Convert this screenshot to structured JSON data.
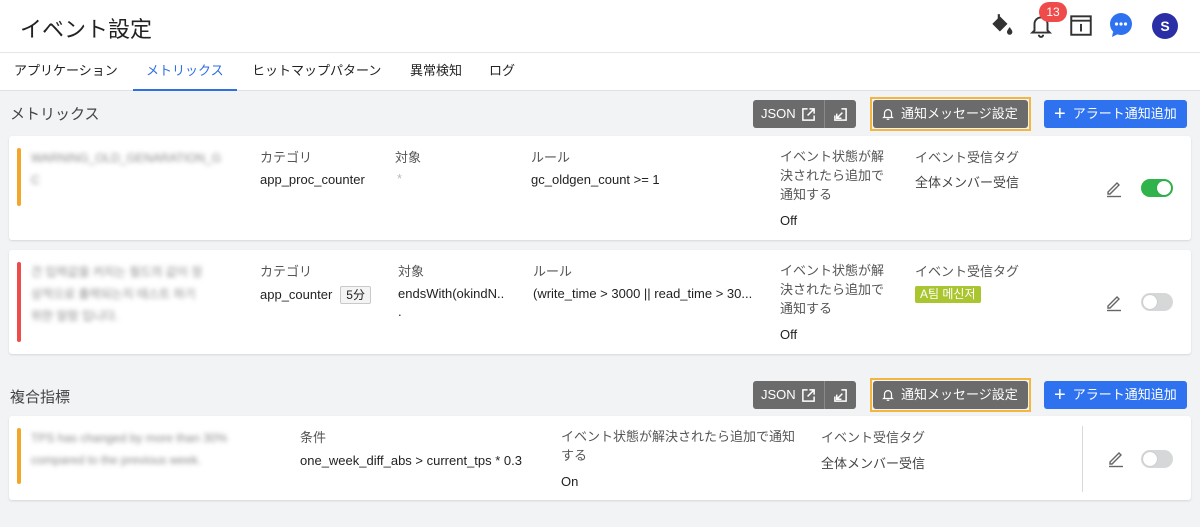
{
  "header": {
    "title": "イベント設定",
    "notification_count": "13",
    "avatar_initial": "S"
  },
  "tabs": [
    {
      "label": "アプリケーション"
    },
    {
      "label": "メトリックス",
      "active": true
    },
    {
      "label": "ヒットマップパターン"
    },
    {
      "label": "異常検知"
    },
    {
      "label": "ログ"
    }
  ],
  "toolbar": {
    "json_label": "JSON",
    "notify_label": "通知メッセージ設定",
    "add_label": "アラート通知追加"
  },
  "metrics": {
    "section_title": "メトリックス",
    "labels": {
      "category": "カテゴリ",
      "target": "対象",
      "rule": "ルール",
      "resolved_line1": "イベント状態が解",
      "resolved_line2": "決されたら追加で",
      "resolved_line3": "通知する",
      "tag": "イベント受信タグ"
    },
    "rows": [
      {
        "name_line1": "WARNING_OLD_GENARATION_G",
        "name_line2": "C",
        "category": "app_proc_counter",
        "target": "*",
        "rule": "gc_oldgen_count >= 1",
        "resolved": "Off",
        "tag": "全体メンバー受信",
        "enabled": true,
        "stripe_color": "#f4a62a"
      },
      {
        "name_line1": "건 입력값을 커지는 필드의 값이 정",
        "name_line2": "상적으로 출력되는지 테스트 하기",
        "name_line3": "위한 알람 입니다.",
        "category": "app_counter",
        "interval": "5分",
        "target": "endsWith(okindN..",
        "target_extra": ".",
        "rule": "(write_time > 3000 || read_time > 30...",
        "resolved": "Off",
        "tag": "A팀 메신저",
        "enabled": false,
        "stripe_color": "#ee4b4b"
      }
    ]
  },
  "composite": {
    "section_title": "複合指標",
    "labels": {
      "condition": "条件",
      "resolved_line1": "イベント状態が解決されたら追加で通知",
      "resolved_line2": "する",
      "tag": "イベント受信タグ"
    },
    "rows": [
      {
        "name_line1": "TPS has changed by more than 30%",
        "name_line2": "compared to the previous week.",
        "condition": "one_week_diff_abs > current_tps * 0.3",
        "resolved": "On",
        "tag": "全体メンバー受信",
        "enabled": false,
        "stripe_color": "#f4a62a"
      }
    ]
  },
  "icons": {
    "paint": "paint-bucket-icon",
    "bell": "bell-icon",
    "notice": "notice-board-icon",
    "chat": "chat-icon",
    "external": "external-link-icon",
    "import": "import-icon",
    "edit": "edit-pencil-icon",
    "plus": "plus-icon"
  },
  "colors": {
    "accent": "#2f6fe4",
    "add_button": "#2f72f0",
    "dark_button": "#6b6b6b",
    "highlight_border": "#f4b63f",
    "toggle_on": "#2fb34a",
    "tag_chip": "#a9c52f",
    "badge": "#f04b4b"
  }
}
